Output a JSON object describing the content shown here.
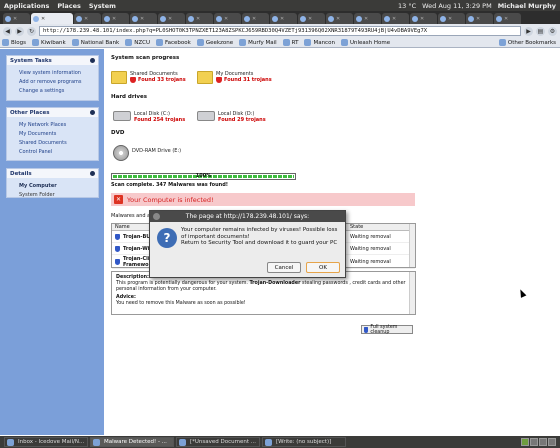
{
  "topbar": {
    "menus": [
      "Applications",
      "Places",
      "System"
    ],
    "temp": "13 °C",
    "datetime": "Wed Aug 11, 3:29 PM",
    "user": "Michael Murphy"
  },
  "browser": {
    "url": "http://178.239.48.101/index.php?q=PL0SHOT0K3TPNZXET123A8ZSPKCJ659RBD30Q4VZETj931396Q02XNR31879T493RU4jB|U4vDBA9VEg7X",
    "bookmarks": [
      "Blogs",
      "Kiwibank",
      "National Bank",
      "NZCU",
      "Facebook",
      "Geekzone",
      "Murfy Mail",
      "RT",
      "Mancon",
      "Unleash Home"
    ],
    "other_bookmarks": "Other Bookmarks"
  },
  "sidebar": {
    "system_tasks": {
      "title": "System Tasks",
      "items": [
        "View system information",
        "Add or remove programs",
        "Change a settings"
      ]
    },
    "other_places": {
      "title": "Other Places",
      "items": [
        "My Network Places",
        "My Documents",
        "Shared Documents",
        "Control Panel"
      ]
    },
    "details": {
      "title": "Details",
      "name": "My Computer",
      "sub": "System Folder"
    }
  },
  "scan": {
    "title": "System scan progress",
    "shared_docs": {
      "name": "Shared Documents",
      "found": "Found 33 trojans"
    },
    "my_docs": {
      "name": "My Documents",
      "found": "Found 31 trojans"
    },
    "hard_drives_label": "Hard drives",
    "local_c": {
      "name": "Local Disk (C:)",
      "found": "Found 254 trojans"
    },
    "local_d": {
      "name": "Local Disk (D:)",
      "found": "Found 29 trojans"
    },
    "dvd_label": "DVD",
    "dvd_drive": {
      "name": "DVD-RAM Drive (E:)"
    },
    "progress_pct": "100%",
    "complete_text": "Scan complete. 347 Malwares was found!"
  },
  "alert": {
    "title": "Your Computer is infected!",
    "caption": "Malwares and actions"
  },
  "threat_table": {
    "headers": [
      "Name",
      "State"
    ],
    "rows": [
      {
        "name": "Trojan-BU",
        "state": "Waiting removal"
      },
      {
        "name": "Trojan-Win",
        "state": "Waiting removal"
      },
      {
        "name": "Trojan-Clic",
        "extra": "Framework",
        "state": "Waiting removal"
      }
    ]
  },
  "description": {
    "label": "Description:",
    "text_prefix": "This program is potentially dangerous for your system. ",
    "threat_name": "Trojan-Downloader",
    "text_suffix": " stealing passwords , credit cards and other personal information from your computer.",
    "advice_label": "Advice:",
    "advice_text": "You need to remove this Malware as soon as possible!"
  },
  "cleanup_button": "Full system cleanup",
  "dialog": {
    "title": "The page at http://178.239.48.101/ says:",
    "message_line1": "Your computer remains infected  by viruses! Possible loss",
    "message_line2": "of important documents!",
    "message_line3": "Return to Security Tool and download it to  guard your PC",
    "cancel": "Cancel",
    "ok": "OK"
  },
  "taskbar": {
    "items": [
      "Inbox - Icedove Mail/N...",
      "Malware Detected! - ...",
      "[*Unsaved Document ...",
      "[Write: (no subject)]"
    ]
  }
}
